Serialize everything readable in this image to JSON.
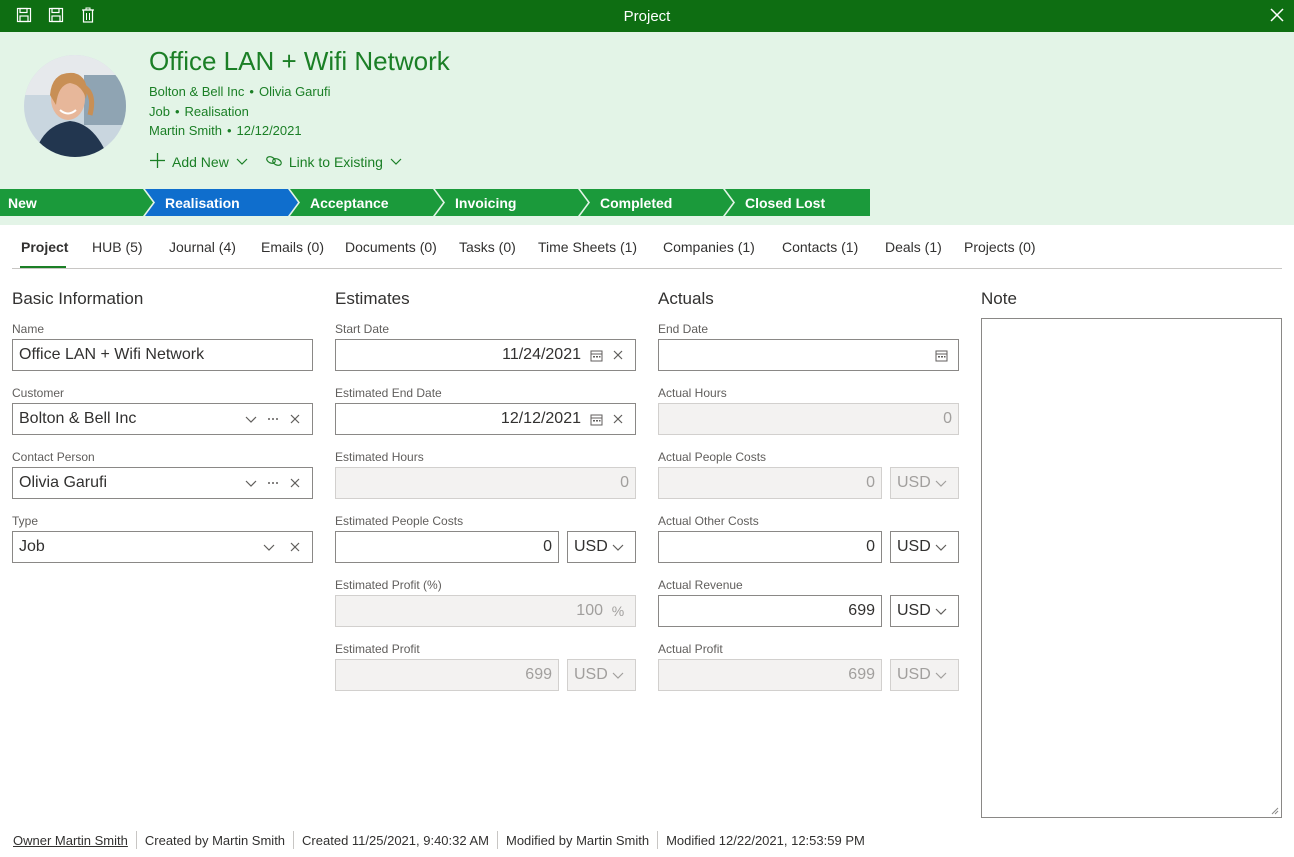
{
  "window": {
    "title": "Project"
  },
  "header": {
    "title": "Office LAN + Wifi Network",
    "company": "Bolton & Bell Inc",
    "contact": "Olivia Garufi",
    "type": "Job",
    "stage": "Realisation",
    "owner": "Martin Smith",
    "date": "12/12/2021",
    "add_new": "Add New",
    "link_existing": "Link to Existing",
    "separator": "•"
  },
  "stages": [
    {
      "label": "New",
      "color": "#1b9a3b",
      "active": false
    },
    {
      "label": "Realisation",
      "color": "#0f6ecd",
      "active": true
    },
    {
      "label": "Acceptance",
      "color": "#1b9a3b",
      "active": false
    },
    {
      "label": "Invoicing",
      "color": "#1b9a3b",
      "active": false
    },
    {
      "label": "Completed",
      "color": "#1b9a3b",
      "active": false
    },
    {
      "label": "Closed Lost",
      "color": "#1b9a3b",
      "active": false
    }
  ],
  "tabs": [
    "Project",
    "HUB (5)",
    "Journal (4)",
    "Emails (0)",
    "Documents (0)",
    "Tasks (0)",
    "Time Sheets (1)",
    "Companies (1)",
    "Contacts (1)",
    "Deals (1)",
    "Projects (0)"
  ],
  "basic": {
    "title": "Basic Information",
    "name_label": "Name",
    "name_value": "Office LAN + Wifi Network",
    "customer_label": "Customer",
    "customer_value": "Bolton & Bell Inc",
    "contact_label": "Contact Person",
    "contact_value": "Olivia Garufi",
    "type_label": "Type",
    "type_value": "Job"
  },
  "estimates": {
    "title": "Estimates",
    "start_label": "Start Date",
    "start_value": "11/24/2021",
    "end_label": "Estimated End Date",
    "end_value": "12/12/2021",
    "hours_label": "Estimated Hours",
    "hours_value": "0",
    "people_label": "Estimated People Costs",
    "people_value": "0",
    "people_currency": "USD",
    "profit_pct_label": "Estimated Profit (%)",
    "profit_pct_value": "100",
    "pct_symbol": "%",
    "profit_label": "Estimated Profit",
    "profit_value": "699",
    "profit_currency": "USD"
  },
  "actuals": {
    "title": "Actuals",
    "end_label": "End Date",
    "end_value": "",
    "hours_label": "Actual Hours",
    "hours_value": "0",
    "people_label": "Actual People Costs",
    "people_value": "0",
    "people_currency": "USD",
    "other_label": "Actual Other Costs",
    "other_value": "0",
    "other_currency": "USD",
    "revenue_label": "Actual Revenue",
    "revenue_value": "699",
    "revenue_currency": "USD",
    "profit_label": "Actual Profit",
    "profit_value": "699",
    "profit_currency": "USD"
  },
  "note": {
    "title": "Note",
    "value": ""
  },
  "footer": {
    "owner": "Owner Martin Smith",
    "created_by": "Created by Martin Smith",
    "created": "Created 11/25/2021, 9:40:32 AM",
    "modified_by": "Modified by Martin Smith",
    "modified": "Modified 12/22/2021, 12:53:59 PM"
  }
}
